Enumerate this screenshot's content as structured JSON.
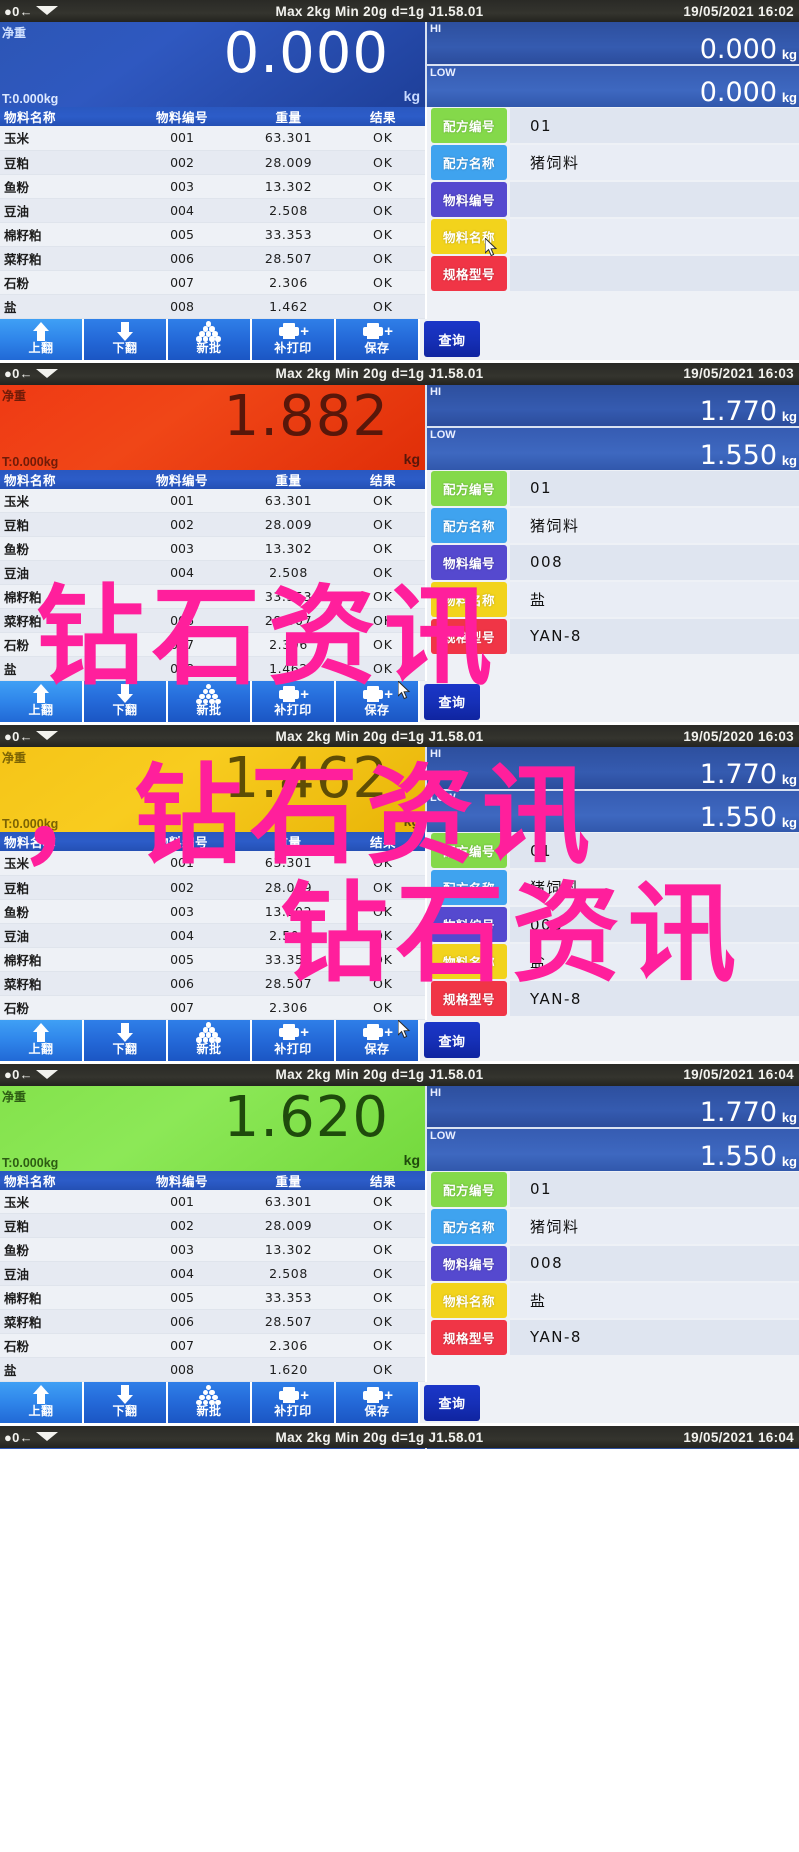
{
  "device": {
    "spec_line": "Max 2kg  Min 20g  d=1g    J1.58.01",
    "zero_icon": "zero-indicator-icon",
    "stable_icon": "stability-indicator-icon",
    "net_label": "净重",
    "kg_unit": "kg",
    "hi_tag": "HI",
    "low_tag": "LOW"
  },
  "table": {
    "headers": [
      "物料名称",
      "物料编号",
      "重量",
      "结果"
    ],
    "rows_full": [
      {
        "name": "玉米",
        "code": "001",
        "weight": "63.301",
        "result": "OK"
      },
      {
        "name": "豆粕",
        "code": "002",
        "weight": "28.009",
        "result": "OK"
      },
      {
        "name": "鱼粉",
        "code": "003",
        "weight": "13.302",
        "result": "OK"
      },
      {
        "name": "豆油",
        "code": "004",
        "weight": "2.508",
        "result": "OK"
      },
      {
        "name": "棉籽粕",
        "code": "005",
        "weight": "33.353",
        "result": "OK"
      },
      {
        "name": "菜籽粕",
        "code": "006",
        "weight": "28.507",
        "result": "OK"
      },
      {
        "name": "石粉",
        "code": "007",
        "weight": "2.306",
        "result": "OK"
      },
      {
        "name": "盐",
        "code": "008",
        "weight": "1.462",
        "result": "OK"
      }
    ],
    "rows_p4": [
      {
        "name": "玉米",
        "code": "001",
        "weight": "63.301",
        "result": "OK"
      },
      {
        "name": "豆粕",
        "code": "002",
        "weight": "28.009",
        "result": "OK"
      },
      {
        "name": "鱼粉",
        "code": "003",
        "weight": "13.302",
        "result": "OK"
      },
      {
        "name": "豆油",
        "code": "004",
        "weight": "2.508",
        "result": "OK"
      },
      {
        "name": "棉籽粕",
        "code": "005",
        "weight": "33.353",
        "result": "OK"
      },
      {
        "name": "菜籽粕",
        "code": "006",
        "weight": "28.507",
        "result": "OK"
      },
      {
        "name": "石粉",
        "code": "007",
        "weight": "2.306",
        "result": "OK"
      },
      {
        "name": "盐",
        "code": "008",
        "weight": "1.620",
        "result": "OK"
      }
    ]
  },
  "prop_keys": {
    "recipe_no": {
      "label": "配方编号",
      "color": "#84d94a"
    },
    "recipe_name": {
      "label": "配方名称",
      "color": "#3fa3ef"
    },
    "mat_no": {
      "label": "物料编号",
      "color": "#5549cf"
    },
    "mat_name": {
      "label": "物料名称",
      "color": "#f2d31c"
    },
    "spec_model": {
      "label": "规格型号",
      "color": "#f03546"
    }
  },
  "toolbar": {
    "buttons": [
      {
        "label": "上翻",
        "icon": "arrow-up-icon"
      },
      {
        "label": "下翻",
        "icon": "arrow-down-icon"
      },
      {
        "label": "新批",
        "icon": "batch-dots-icon"
      },
      {
        "label": "补打印",
        "icon": "printer-plus-icon"
      },
      {
        "label": "保存",
        "icon": "printer-save-icon"
      }
    ],
    "query_label": "查询"
  },
  "panels": [
    {
      "id": "panel-1",
      "datetime": "19/05/2021  16:02",
      "net_weight": "0.000",
      "tare": "T:0.000kg",
      "weight_color": "blue",
      "hi": "0.000",
      "low": "0.000",
      "props": {
        "recipe_no": "01",
        "recipe_name": "猪饲料",
        "mat_no": "",
        "mat_name": "",
        "spec_model": ""
      },
      "cursor_on": "mat_name"
    },
    {
      "id": "panel-2",
      "datetime": "19/05/2021  16:03",
      "net_weight": "1.882",
      "tare": "T:0.000kg",
      "weight_color": "red",
      "hi": "1.770",
      "low": "1.550",
      "props": {
        "recipe_no": "01",
        "recipe_name": "猪饲料",
        "mat_no": "008",
        "mat_name": "盐",
        "spec_model": "YAN-8"
      },
      "cursor_on": "save"
    },
    {
      "id": "panel-3",
      "datetime": "19/05/2020  16:03",
      "net_weight": "1.462",
      "tare": "T:0.000kg",
      "weight_color": "yellow",
      "hi": "1.770",
      "low": "1.550",
      "props": {
        "recipe_no": "01",
        "recipe_name": "猪饲料",
        "mat_no": "008",
        "mat_name": "盐",
        "spec_model": "YAN-8"
      },
      "cursor_on": "save"
    },
    {
      "id": "panel-4",
      "datetime": "19/05/2021  16:04",
      "net_weight": "1.620",
      "tare": "T:0.000kg",
      "weight_color": "green",
      "hi": "1.770",
      "low": "1.550",
      "props": {
        "recipe_no": "01",
        "recipe_name": "猪饲料",
        "mat_no": "008",
        "mat_name": "盐",
        "spec_model": "YAN-8"
      },
      "cursor_on": "none"
    },
    {
      "id": "panel-5-partial",
      "datetime": "19/05/2021  16:04",
      "net_weight": "",
      "tare": "",
      "weight_color": "blue",
      "hi": "",
      "low": "",
      "props": {},
      "cursor_on": "none"
    }
  ],
  "watermark": {
    "line1": "钻石资讯",
    "line2": "，钻石资讯",
    "color": "#ff1f9c"
  }
}
